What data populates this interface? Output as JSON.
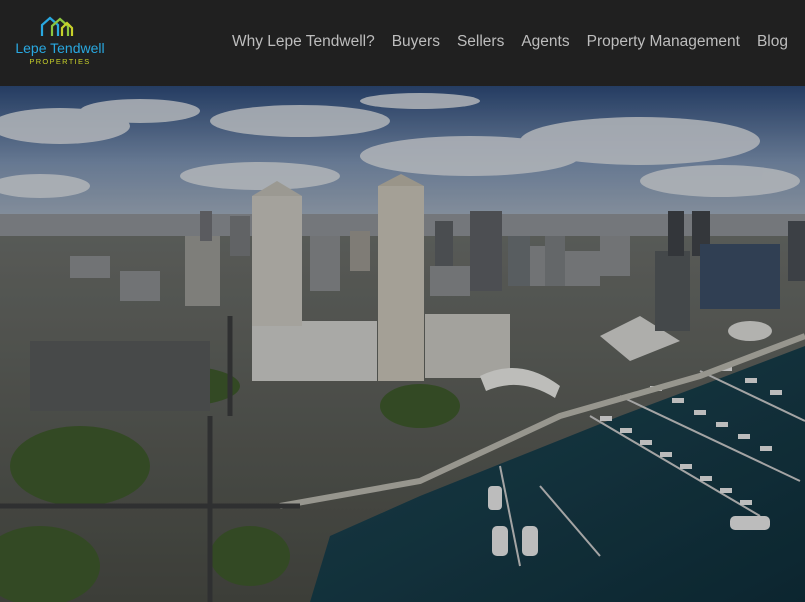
{
  "brand": {
    "name": "Lepe Tendwell",
    "tagline": "PROPERTIES",
    "colors": {
      "name": "#29a8e0",
      "tagline": "#c8d12a",
      "roof_blue": "#29a8e0",
      "roof_green": "#8cc63f"
    }
  },
  "nav": {
    "items": [
      {
        "label": "Why Lepe Tendwell?"
      },
      {
        "label": "Buyers"
      },
      {
        "label": "Sellers"
      },
      {
        "label": "Agents"
      },
      {
        "label": "Property Management"
      },
      {
        "label": "Blog"
      }
    ]
  },
  "hero": {
    "image_subject": "aerial-city-waterfront-marina"
  },
  "colors": {
    "header_bg": "#202020",
    "nav_text": "#bdbdbd"
  }
}
